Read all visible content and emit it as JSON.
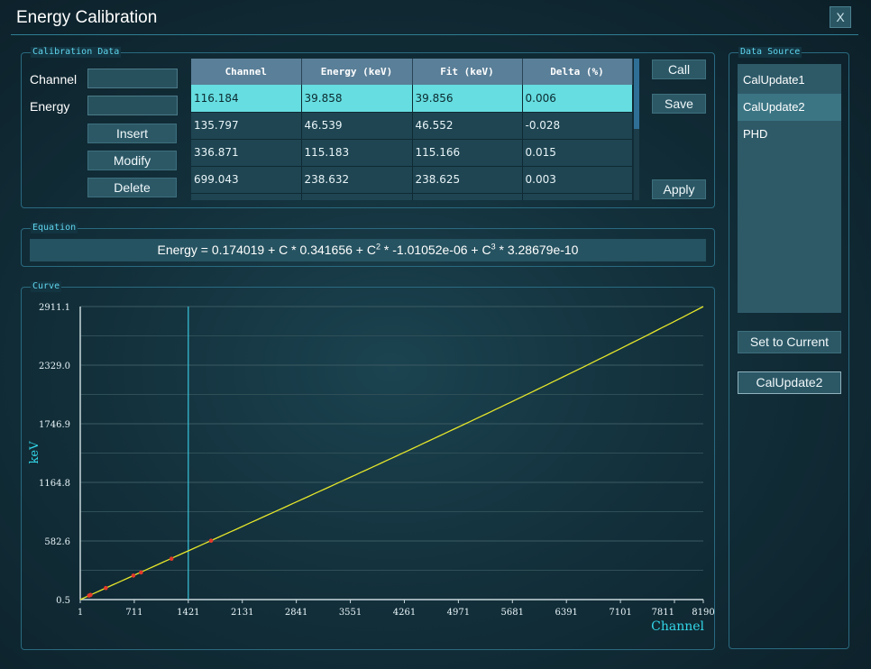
{
  "window": {
    "title": "Energy Calibration",
    "close_label": "X"
  },
  "calibration": {
    "group_label": "Calibration Data",
    "channel_label": "Channel",
    "energy_label": "Energy",
    "channel_value": "",
    "energy_value": "",
    "insert_label": "Insert",
    "modify_label": "Modify",
    "delete_label": "Delete",
    "columns": [
      "Channel",
      "Energy (keV)",
      "Fit (keV)",
      "Delta (%)"
    ],
    "rows": [
      [
        "116.184",
        "39.858",
        "39.856",
        "0.006"
      ],
      [
        "135.797",
        "46.539",
        "46.552",
        "-0.028"
      ],
      [
        "336.871",
        "115.183",
        "115.166",
        "0.015"
      ],
      [
        "699.043",
        "238.632",
        "238.625",
        "0.003"
      ]
    ],
    "selected_row": 0,
    "call_label": "Call",
    "save_label": "Save",
    "apply_label": "Apply"
  },
  "equation": {
    "group_label": "Equation",
    "p1": "Energy = 0.174019 + C * 0.341656 + C",
    "e1": "2",
    "p2": " * -1.01052e-06 + C",
    "e2": "3",
    "p3": " * 3.28679e-10"
  },
  "data_source": {
    "group_label": "Data Source",
    "items": [
      "CalUpdate1",
      "CalUpdate2",
      "PHD"
    ],
    "selected": 1,
    "set_current_label": "Set to Current",
    "current_value": "CalUpdate2"
  },
  "curve": {
    "group_label": "Curve",
    "colors": {
      "curve": "#e6e62a",
      "cursor": "#39c6dc",
      "points": "#e43a2a",
      "axis_title": "#33d6e8"
    }
  },
  "chart_data": {
    "type": "line",
    "xlabel": "Channel",
    "ylabel": "keV",
    "xlim": [
      1,
      8190
    ],
    "ylim": [
      0.5,
      2911.1
    ],
    "x_ticks": [
      "1",
      "711",
      "1421",
      "2131",
      "2841",
      "3551",
      "4261",
      "4971",
      "5681",
      "6391",
      "7101",
      "7811",
      "8190"
    ],
    "y_ticks": [
      "0.5",
      "582.6",
      "1164.8",
      "1746.9",
      "2329.0",
      "2911.1"
    ],
    "grid": true,
    "cursor_x": 1421,
    "coefficients": [
      0.174019,
      0.341656,
      -1.01052e-06,
      3.28679e-10
    ],
    "points": [
      {
        "x": 116.184,
        "y": 39.858
      },
      {
        "x": 135.797,
        "y": 46.539
      },
      {
        "x": 336.871,
        "y": 115.183
      },
      {
        "x": 699.043,
        "y": 238.632
      },
      {
        "x": 800,
        "y": 270
      },
      {
        "x": 1200,
        "y": 406
      },
      {
        "x": 1720,
        "y": 585
      }
    ]
  }
}
